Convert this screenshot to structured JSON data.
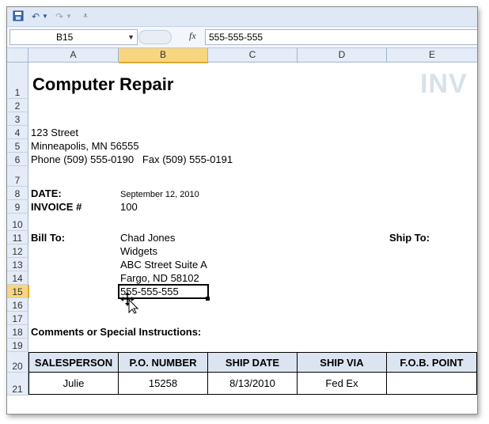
{
  "formula_bar": {
    "name_box": "B15",
    "fx_label": "fx",
    "value": "555-555-555"
  },
  "columns": [
    "A",
    "B",
    "C",
    "D",
    "E"
  ],
  "rows": [
    "1",
    "2",
    "3",
    "4",
    "5",
    "6",
    "7",
    "8",
    "9",
    "10",
    "11",
    "12",
    "13",
    "14",
    "15",
    "16",
    "17",
    "18",
    "19",
    "20",
    "21"
  ],
  "sheet": {
    "title": "Computer Repair",
    "watermark": "INV",
    "street": "123 Street",
    "city": "Minneapolis, MN 56555",
    "phone": "Phone (509) 555-0190   Fax (509) 555-0191",
    "date_label": "DATE:",
    "date_value": "September 12, 2010",
    "invoice_label": "INVOICE #",
    "invoice_value": "100",
    "bill_to_label": "Bill To:",
    "bill_name": "Chad Jones",
    "bill_company": "Widgets",
    "bill_street": "ABC Street Suite A",
    "bill_city": "Fargo, ND 58102",
    "bill_phone": "555-555-555",
    "ship_to_label": "Ship To:",
    "comments_label": "Comments or Special Instructions:"
  },
  "order_table": {
    "headers": [
      "SALESPERSON",
      "P.O. NUMBER",
      "SHIP DATE",
      "SHIP VIA",
      "F.O.B. POINT"
    ],
    "row": [
      "Julie",
      "15258",
      "8/13/2010",
      "Fed Ex",
      ""
    ]
  },
  "colors": {
    "header_bg": "#e4ecf7",
    "selected_header": "#f8d580",
    "table_header_bg": "#dbe5f1"
  }
}
